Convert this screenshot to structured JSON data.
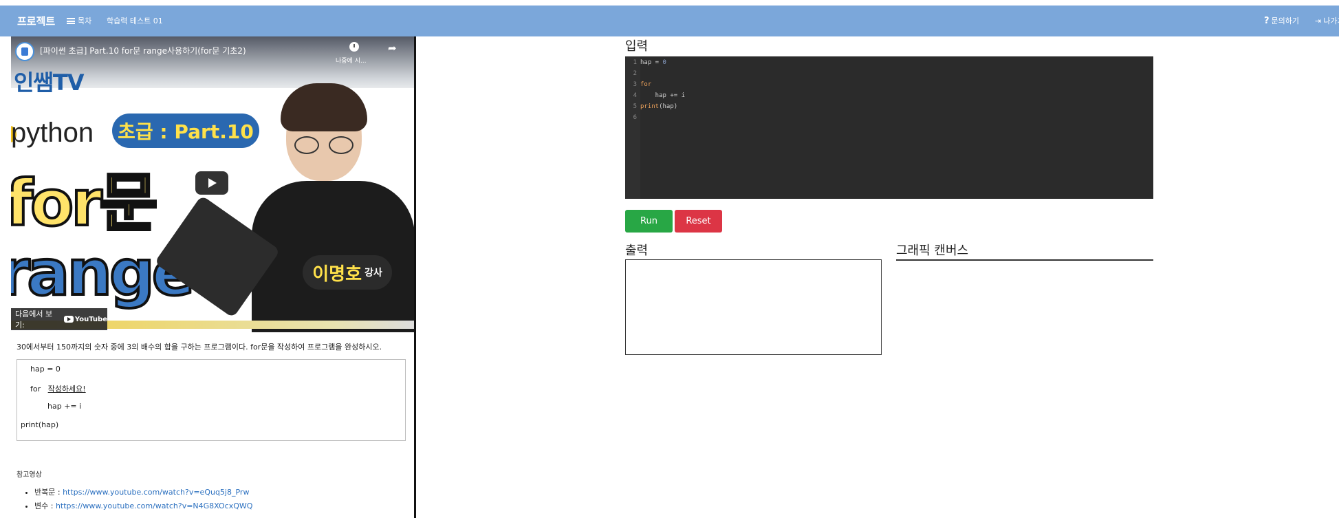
{
  "navbar": {
    "brand": "프로젝트",
    "toc_label": "목차",
    "test_label": "학습력 테스트 01",
    "inquiry_label": "문의하기",
    "exit_label": "나가기"
  },
  "video": {
    "title": "[파이썬 초급] Part.10 for문 range사용하기(for문 기초2)",
    "watch_later": "나중에 시...",
    "channel": "인쌤TV",
    "language": "python",
    "level": "초급 : Part.10",
    "big_text_1": "for문",
    "big_text_2": "range",
    "presenter_name": "이명호",
    "presenter_title": "강사",
    "watch_on_label": "다음에서 보기:",
    "youtube_label": "YouTube"
  },
  "problem": {
    "description": "30에서부터 150까지의 숫자 중에 3의 배수의 합을 구하는 프로그램이다. for문을 작성하여 프로그램을 완성하시오.",
    "code_line_1": "hap = 0",
    "code_for": "for",
    "code_placeholder": "작성하세요!",
    "code_line_3": "hap += i",
    "code_line_4": "print(hap)"
  },
  "references": {
    "title": "참고영상",
    "items": [
      {
        "label": "반복문 : ",
        "url": "https://www.youtube.com/watch?v=eQuq5j8_Prw"
      },
      {
        "label": "변수 : ",
        "url": "https://www.youtube.com/watch?v=N4G8XOcxQWQ"
      }
    ]
  },
  "editor": {
    "title": "입력",
    "lines": [
      {
        "n": "1",
        "code": "hap = 0"
      },
      {
        "n": "2",
        "code": ""
      },
      {
        "n": "3",
        "code": "for"
      },
      {
        "n": "4",
        "code": "    hap += i"
      },
      {
        "n": "5",
        "code": "print(hap)"
      },
      {
        "n": "6",
        "code": ""
      }
    ]
  },
  "buttons": {
    "run": "Run",
    "reset": "Reset"
  },
  "output": {
    "title": "출력"
  },
  "canvas": {
    "title": "그래픽 캔버스"
  },
  "colors": {
    "navbar": "#7ba7da",
    "run": "#28a745",
    "reset": "#dc3545",
    "editor_bg": "#2b2b2b"
  }
}
